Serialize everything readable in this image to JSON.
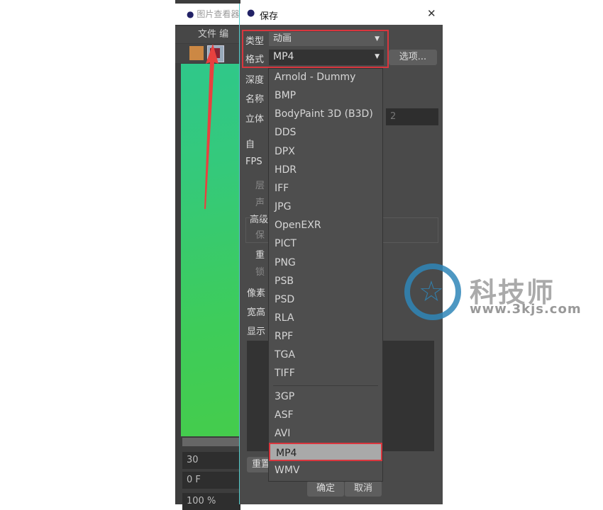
{
  "viewer": {
    "title": "图片查看器",
    "menu": [
      "文件",
      "编"
    ],
    "fields": [
      "30",
      "0 F",
      "100 %"
    ]
  },
  "dialog": {
    "title": "保存",
    "close": "✕",
    "type_label": "类型",
    "type_value": "动画",
    "format_label": "格式",
    "format_value": "MP4",
    "options_button": "选项...",
    "side_labels": [
      "深度",
      "名称",
      "立体",
      "自",
      "FPS",
      "层",
      "声",
      "高级",
      "保",
      "重",
      "锁",
      "像素",
      "宽高",
      "显示"
    ],
    "stereo_value": "2",
    "reset_button": "重置",
    "ok_button": "确定",
    "cancel_button": "取消"
  },
  "format_list": {
    "items": [
      "Arnold - Dummy",
      "BMP",
      "BodyPaint 3D (B3D)",
      "DDS",
      "DPX",
      "HDR",
      "IFF",
      "JPG",
      "OpenEXR",
      "PICT",
      "PNG",
      "PSB",
      "PSD",
      "RLA",
      "RPF",
      "TGA",
      "TIFF"
    ],
    "video_items": [
      "3GP",
      "ASF",
      "AVI",
      "MP4",
      "WMV"
    ],
    "selected": "MP4"
  },
  "watermark": {
    "brand": "科技师",
    "url": "www.3kjs.com"
  },
  "colors": {
    "highlight": "#d9363e",
    "arrow": "#e8413f"
  }
}
